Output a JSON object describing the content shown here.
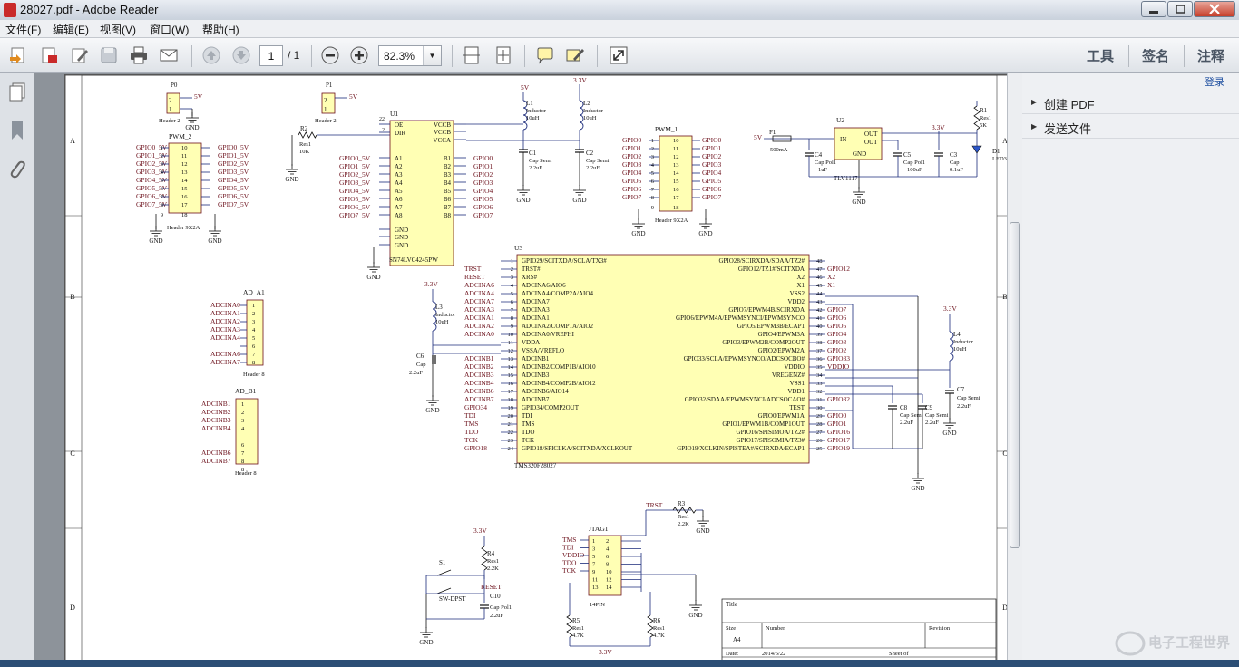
{
  "window": {
    "title": "28027.pdf - Adobe Reader"
  },
  "menu": [
    "文件(F)",
    "编辑(E)",
    "视图(V)",
    "窗口(W)",
    "帮助(H)"
  ],
  "toolbar": {
    "page_current": "1",
    "page_total": "/ 1",
    "zoom": "82.3%",
    "tools_label": "工具",
    "sign_label": "签名",
    "comment_label": "注释"
  },
  "right_panel": {
    "login": "登录",
    "sections": [
      "创建 PDF",
      "发送文件"
    ]
  },
  "schematic": {
    "border_rows": [
      "A",
      "B",
      "C",
      "D"
    ],
    "p0": {
      "ref": "P0",
      "name": "Header 2",
      "net": "5V",
      "gnd": "GND"
    },
    "p1": {
      "ref": "P1",
      "name": "Header 2",
      "net": "5V"
    },
    "pwm2": {
      "ref": "PWM_2",
      "name": "Header 9X2A",
      "left": [
        "GPIO0_5V",
        "GPIO1_5V",
        "GPIO2_5V",
        "GPIO3_5V",
        "GPIO4_5V",
        "GPIO5_5V",
        "GPIO6_5V",
        "GPIO7_5V"
      ],
      "right": [
        "GPIO0_5V",
        "GPIO1_5V",
        "GPIO2_5V",
        "GPIO3_5V",
        "GPIO4_5V",
        "GPIO5_5V",
        "GPIO6_5V",
        "GPIO7_5V"
      ],
      "pins_l": [
        "1",
        "2",
        "3",
        "4",
        "5",
        "6",
        "7",
        "8",
        "9"
      ],
      "pins_r": [
        "10",
        "11",
        "12",
        "13",
        "14",
        "15",
        "16",
        "17",
        "18"
      ]
    },
    "r2": {
      "ref": "R2",
      "type": "Res1",
      "value": "10K"
    },
    "u1": {
      "ref": "U1",
      "part": "SN74LVC4245PW",
      "left_pins": [
        "OE",
        "DIR",
        "A1",
        "A2",
        "A3",
        "A4",
        "A5",
        "A6",
        "A7",
        "A8",
        "GND",
        "GND",
        "GND"
      ],
      "right_pins": [
        "VCCB",
        "VCCB",
        "VCCA",
        "B1",
        "B2",
        "B3",
        "B4",
        "B5",
        "B6",
        "B7",
        "B8"
      ],
      "left_nets": [
        "GPIO0_5V",
        "GPIO1_5V",
        "GPIO2_5V",
        "GPIO3_5V",
        "GPIO4_5V",
        "GPIO5_5V",
        "GPIO6_5V",
        "GPIO7_5V"
      ],
      "right_nets": [
        "GPIO0",
        "GPIO1",
        "GPIO2",
        "GPIO3",
        "GPIO4",
        "GPIO5",
        "GPIO6",
        "GPIO7"
      ]
    },
    "l1": {
      "ref": "L1",
      "type": "Inductor",
      "value": "10uH",
      "net": "5V"
    },
    "l2": {
      "ref": "L2",
      "type": "Inductor",
      "value": "10uH",
      "net": "3.3V"
    },
    "c1": {
      "ref": "C1",
      "type": "Cap Semi",
      "value": "2.2uF"
    },
    "c2": {
      "ref": "C2",
      "type": "Cap Semi",
      "value": "2.2uF"
    },
    "pwm1": {
      "ref": "PWM_1",
      "name": "Header 9X2A",
      "nets": [
        "GPIO0",
        "GPIO1",
        "GPIO2",
        "GPIO3",
        "GPIO4",
        "GPIO5",
        "GPIO6",
        "GPIO7"
      ]
    },
    "power": {
      "f1": "F1",
      "f1_val": "500mA",
      "u2": "U2",
      "u2_part": "TLV1117",
      "c4": "C4",
      "c4_type": "Cap Pol1",
      "c4_val": "1uF",
      "c5": "C5",
      "c5_type": "Cap Pol1",
      "c5_val": "100uF",
      "c3": "C3",
      "c3_type": "Cap",
      "c3_val": "0.1uF",
      "r1": "R1",
      "r1_type": "Res1",
      "r1_val": "5K",
      "d1": "D1",
      "d1_type": "LED3",
      "in": "IN",
      "out": "OUT",
      "gnd": "GND",
      "v5": "5V",
      "v33": "3.3V"
    },
    "u3": {
      "ref": "U3",
      "part": "TMS320F28027",
      "left": [
        "GPIO29/SCITXDA/SCLA/TX3#",
        "TRST#",
        "XRS#",
        "ADCINA6/AIO6",
        "ADCINA4/COMP2A/AIO4",
        "ADCINA7",
        "ADCINA3",
        "ADCINA1",
        "ADCINA2/COMP1A/AIO2",
        "ADCINA0/VREFHI",
        "VDDA",
        "VSSA/VREFLO",
        "ADCINB1",
        "ADCINB2/COMP1B/AIO10",
        "ADCINB3",
        "ADCINB4/COMP2B/AIO12",
        "ADCINB6/AIO14",
        "ADCINB7",
        "GPIO34/COMP2OUT",
        "TDI",
        "TMS",
        "TDO",
        "TCK",
        "GPIO18/SPICLKA/SCITXDA/XCLKOUT"
      ],
      "right": [
        "GPIO28/SCIRXDA/SDAA/TZ2#",
        "GPIO12/TZ1#/SCITXDA",
        "X2",
        "X1",
        "VSS2",
        "VDD2",
        "GPIO7/EPWM4B/SCIRXDA",
        "GPIO6/EPWM4A/EPWMSYNCI/EPWMSYNCO",
        "GPIO5/EPWM3B/ECAP1",
        "GPIO4/EPWM3A",
        "GPIO3/EPWM2B/COMP2OUT",
        "GPIO2/EPWM2A",
        "GPIO33/SCLA/EPWMSYNCO/ADCSOCBO#",
        "VDDIO",
        "VREGENZ#",
        "VSS1",
        "VDD1",
        "GPIO32/SDAA/EPWMSYNCI/ADCSOCAO#",
        "TEST",
        "GPIO0/EPWM1A",
        "GPIO1/EPWM1B/COMP1OUT",
        "GPIO16/SPISIMOA/TZ2#",
        "GPIO17/SPISOMIA/TZ3#",
        "GPIO19/XCLKIN/SPISTEA#/SCIRXDA/ECAP1"
      ],
      "left_nets": [
        "",
        "TRST",
        "RESET",
        "ADCINA6",
        "ADCINA4",
        "ADCINA7",
        "ADCINA3",
        "ADCINA1",
        "ADCINA2",
        "ADCINA0",
        "",
        "",
        "ADCINB1",
        "ADCINB2",
        "ADCINB3",
        "ADCINB4",
        "ADCINB6",
        "ADCINB7",
        "GPIO34",
        "TDI",
        "TMS",
        "TDO",
        "TCK",
        "GPIO18"
      ],
      "right_nets": [
        "",
        "GPIO12",
        "X2",
        "X1",
        "",
        "",
        "GPIO7",
        "GPIO6",
        "GPIO5",
        "GPIO4",
        "GPIO3",
        "GPIO2",
        "GPIO33",
        "VDDIO",
        "",
        "",
        "",
        "GPIO32",
        "",
        "GPIO0",
        "GPIO1",
        "GPIO16",
        "GPIO17",
        "GPIO19"
      ],
      "lpins": [
        "1",
        "2",
        "3",
        "4",
        "5",
        "6",
        "7",
        "8",
        "9",
        "10",
        "11",
        "12",
        "13",
        "14",
        "15",
        "16",
        "17",
        "18",
        "19",
        "20",
        "21",
        "22",
        "23",
        "24"
      ],
      "rpins": [
        "48",
        "47",
        "46",
        "45",
        "44",
        "43",
        "42",
        "41",
        "40",
        "39",
        "38",
        "37",
        "36",
        "35",
        "34",
        "33",
        "32",
        "31",
        "30",
        "29",
        "28",
        "27",
        "26",
        "25"
      ]
    },
    "ad_a1": {
      "ref": "AD_A1",
      "name": "Header 8",
      "nets": [
        "ADCINA0",
        "ADCINA1",
        "ADCINA2",
        "ADCINA3",
        "ADCINA4",
        "",
        "ADCINA6",
        "ADCINA7"
      ]
    },
    "ad_b1": {
      "ref": "AD_B1",
      "name": "Header 8",
      "nets": [
        "ADCINB1",
        "ADCINB2",
        "ADCINB3",
        "ADCINB4",
        "",
        "ADCINB6",
        "ADCINB7"
      ]
    },
    "l3": {
      "ref": "L3",
      "type": "Inductor",
      "value": "10uH",
      "net": "3.3V"
    },
    "c6": {
      "ref": "C6",
      "type": "Cap",
      "value": "2.2uF"
    },
    "l4": {
      "ref": "L4",
      "type": "Inductor",
      "value": "10uH",
      "net": "3.3V"
    },
    "c7": {
      "ref": "C7",
      "type": "Cap Semi",
      "value": "2.2uF"
    },
    "c8": {
      "ref": "C8",
      "type": "Cap Semi",
      "value": "2.2uF"
    },
    "c9": {
      "ref": "C9",
      "type": "Cap Semi",
      "value": "2.2uF"
    },
    "jtag": {
      "ref": "JTAG1",
      "name": "14PIN",
      "nets": [
        "TMS",
        "TDI",
        "VDDIO",
        "TDO",
        "TCK"
      ],
      "trst": "TRST"
    },
    "r3": {
      "ref": "R3",
      "type": "Res1",
      "value": "2.2K"
    },
    "r4": {
      "ref": "R4",
      "type": "Res1",
      "value": "2.2K"
    },
    "r5": {
      "ref": "R5",
      "type": "Res1",
      "value": "4.7K"
    },
    "r6": {
      "ref": "R6",
      "type": "Res1",
      "value": "4.7K"
    },
    "s1": {
      "ref": "S1",
      "name": "SW-DPST",
      "reset": "RESET"
    },
    "c10": {
      "ref": "C10",
      "type": "Cap Pol1",
      "value": "2.2uF"
    },
    "titleblock": {
      "title": "Title",
      "size": "Size",
      "size_val": "A4",
      "number": "Number",
      "revision": "Revision",
      "date": "Date:",
      "date_val": "2014/5/22",
      "sheet": "Sheet   of"
    }
  },
  "watermark": "电子工程世界"
}
